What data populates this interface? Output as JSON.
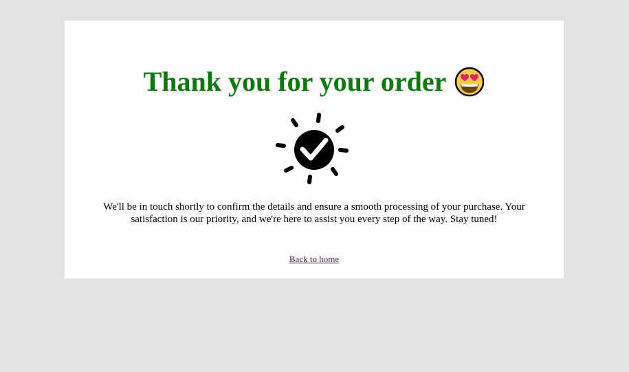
{
  "page": {
    "title": "Thank you for your order",
    "emoji_name": "heart-eyes-emoji-icon",
    "success_icon_name": "success-checkmark-icon",
    "message": "We'll be in touch shortly to confirm the details and ensure a smooth processing of your purchase. Your satisfaction is our priority, and we're here to assist you every step of the way. Stay tuned!",
    "back_link_label": "Back to home"
  },
  "colors": {
    "background": "#e2e3e5",
    "card": "#ffffff",
    "title": "#0a7a0a",
    "link": "#4b1b7a"
  }
}
